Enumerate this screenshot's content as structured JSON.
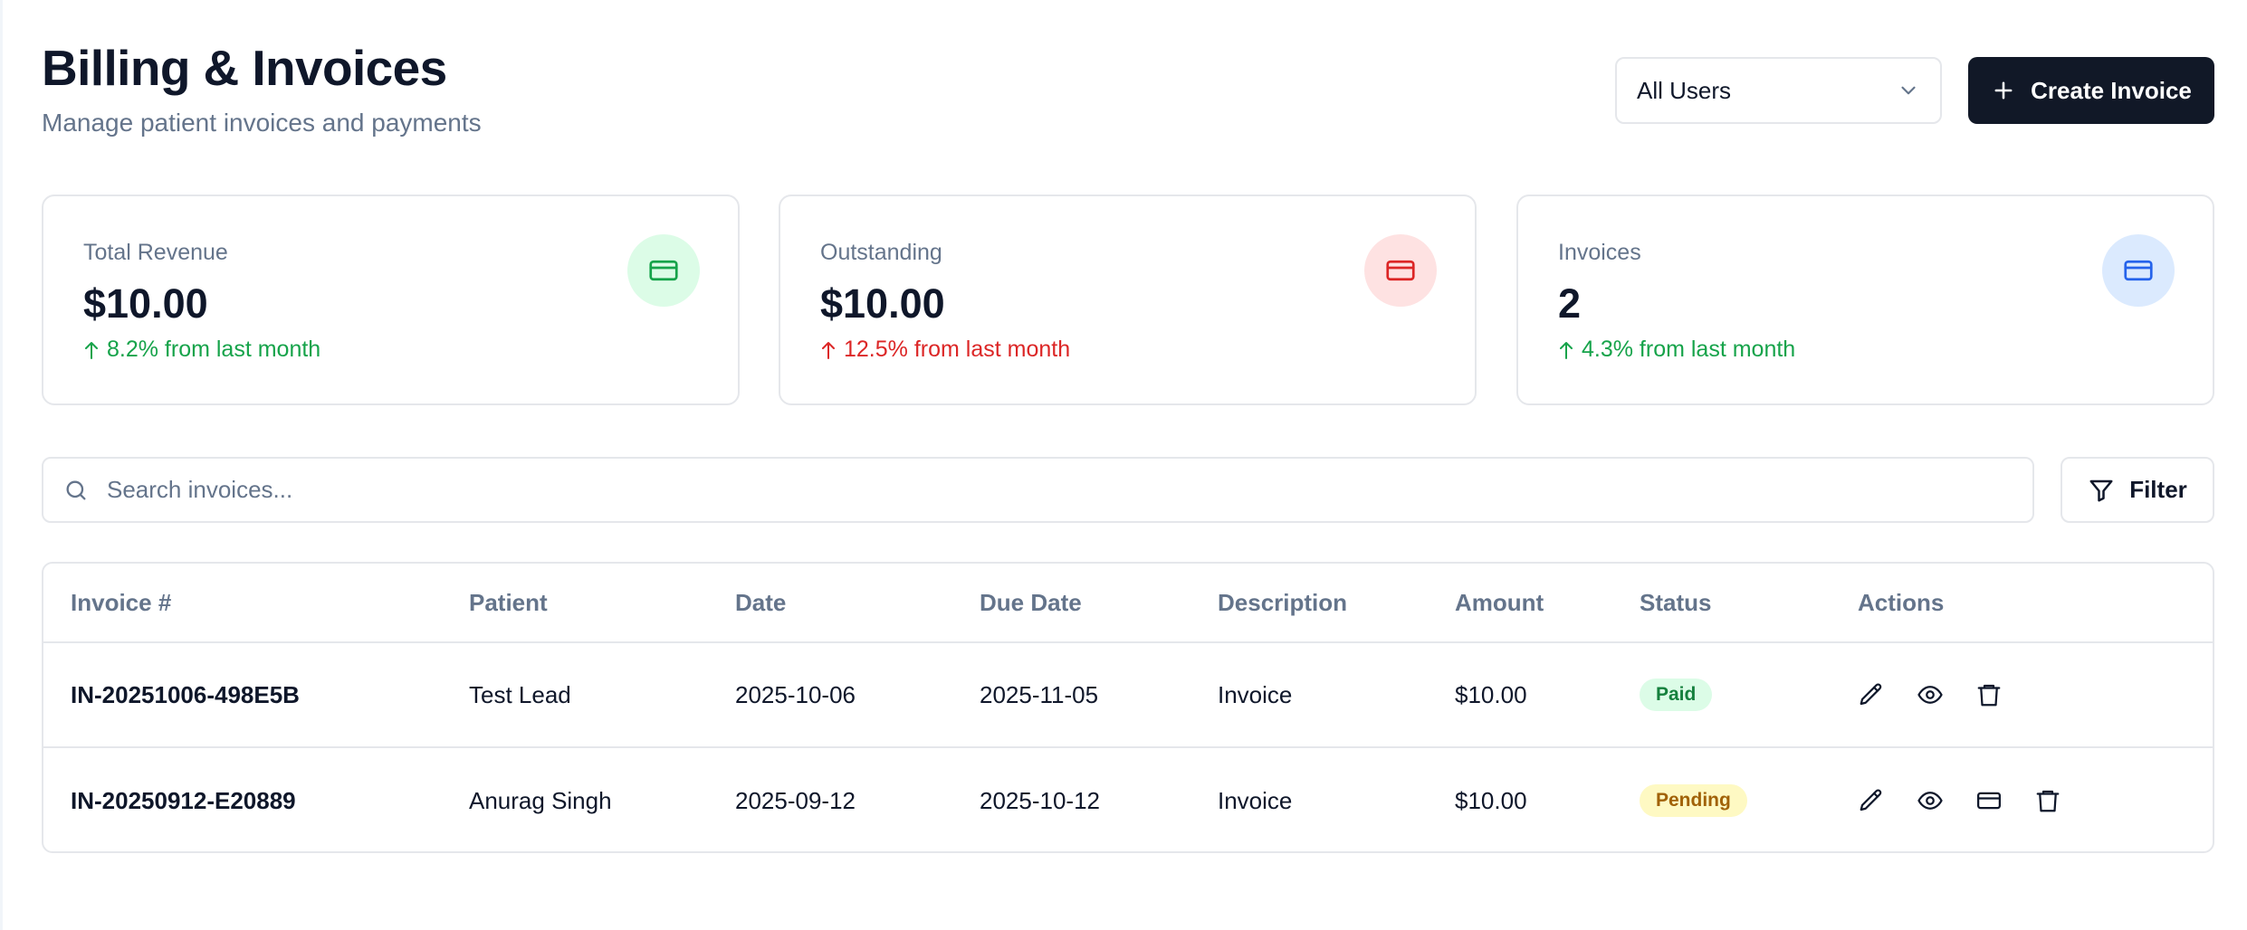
{
  "header": {
    "title": "Billing & Invoices",
    "subtitle": "Manage patient invoices and payments",
    "user_filter": {
      "selected": "All Users",
      "icon": "chevron-down-icon"
    },
    "create_button": {
      "label": "Create Invoice",
      "icon": "plus-icon"
    }
  },
  "stats": [
    {
      "label": "Total Revenue",
      "value": "$10.00",
      "change": "8.2% from last month",
      "trend": "up",
      "tone": "green",
      "icon": "credit-card-icon",
      "icon_color": "#16a34a",
      "icon_bg": "#dcfce7"
    },
    {
      "label": "Outstanding",
      "value": "$10.00",
      "change": "12.5% from last month",
      "trend": "up",
      "tone": "red",
      "icon": "credit-card-icon",
      "icon_color": "#dc2626",
      "icon_bg": "#fee2e2"
    },
    {
      "label": "Invoices",
      "value": "2",
      "change": "4.3% from last month",
      "trend": "up",
      "tone": "green",
      "icon": "credit-card-icon",
      "icon_color": "#2563eb",
      "icon_bg": "#dbeafe"
    }
  ],
  "search": {
    "placeholder": "Search invoices...",
    "value": "",
    "icon": "search-icon"
  },
  "filter_button": {
    "label": "Filter",
    "icon": "filter-icon"
  },
  "table": {
    "columns": [
      "Invoice #",
      "Patient",
      "Date",
      "Due Date",
      "Description",
      "Amount",
      "Status",
      "Actions"
    ],
    "rows": [
      {
        "invoice": "IN-20251006-498E5B",
        "patient": "Test Lead",
        "date": "2025-10-06",
        "due_date": "2025-11-05",
        "description": "Invoice",
        "amount": "$10.00",
        "status": "Paid",
        "actions": [
          "edit-icon",
          "view-icon",
          "delete-icon"
        ]
      },
      {
        "invoice": "IN-20250912-E20889",
        "patient": "Anurag Singh",
        "date": "2025-09-12",
        "due_date": "2025-10-12",
        "description": "Invoice",
        "amount": "$10.00",
        "status": "Pending",
        "actions": [
          "edit-icon",
          "view-icon",
          "payment-icon",
          "delete-icon"
        ]
      }
    ]
  },
  "colors": {
    "primary_button": "#111827",
    "link": "#2563eb",
    "positive": "#16a34a",
    "negative": "#dc2626",
    "muted_text": "#64748b",
    "border": "#e5e7eb"
  }
}
